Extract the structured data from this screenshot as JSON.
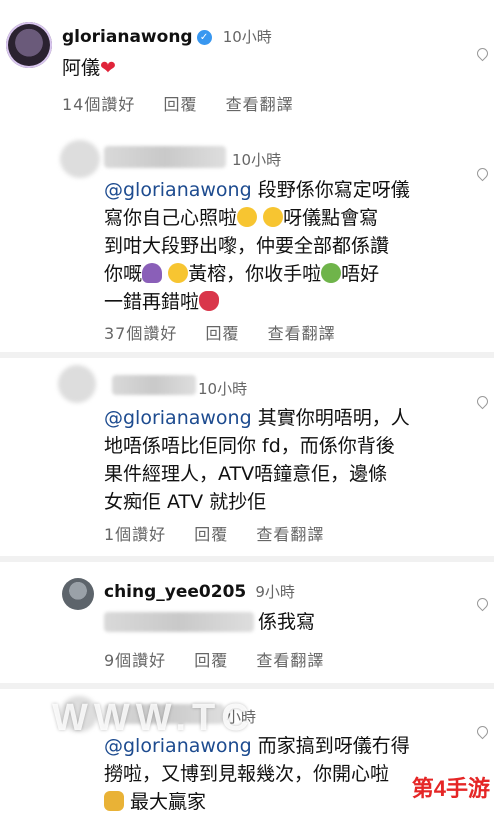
{
  "comments": [
    {
      "username": "glorianawong",
      "time": "10小時",
      "text": "阿儀",
      "likes": "14個讚好",
      "reply": "回覆",
      "translate": "查看翻譯"
    },
    {
      "time": "10小時",
      "mention": "@glorianawong",
      "text_1": "段野係你寫定呀儀",
      "text_2": "寫你自己心照啦",
      "text_3": "呀儀點會寫",
      "text_4": "到咁大段野出嚟，仲要全部都係讚",
      "text_5": "你嘅",
      "text_6": "黃榕，你收手啦",
      "text_7": "唔好",
      "text_8": "一錯再錯啦",
      "likes": "37個讚好",
      "reply": "回覆",
      "translate": "查看翻譯"
    },
    {
      "time": "10小時",
      "mention": "@glorianawong",
      "text_1": "其實你明唔明，人",
      "text_2": "地唔係唔比佢同你 fd，而係你背後",
      "text_3": "果件經理人，ATV唔鐘意佢，邊條",
      "text_4": "女痴佢 ATV 就抄佢",
      "likes": "1個讚好",
      "reply": "回覆",
      "translate": "查看翻譯"
    },
    {
      "username": "ching_yee0205",
      "time": "9小時",
      "text": "係我寫",
      "likes": "9個讚好",
      "reply": "回覆",
      "translate": "查看翻譯"
    },
    {
      "time": "小時",
      "mention": "@glorianawong",
      "text_1": "而家搞到呀儀冇得",
      "text_2": "撈啦，又博到見報幾次，你開心啦",
      "text_3": "最大贏家"
    }
  ],
  "watermark": "WWW.TC",
  "logo": "第4手游",
  "colors": {
    "mention": "#1d4b8f",
    "meta": "#666666",
    "verified": "#3897f0"
  }
}
